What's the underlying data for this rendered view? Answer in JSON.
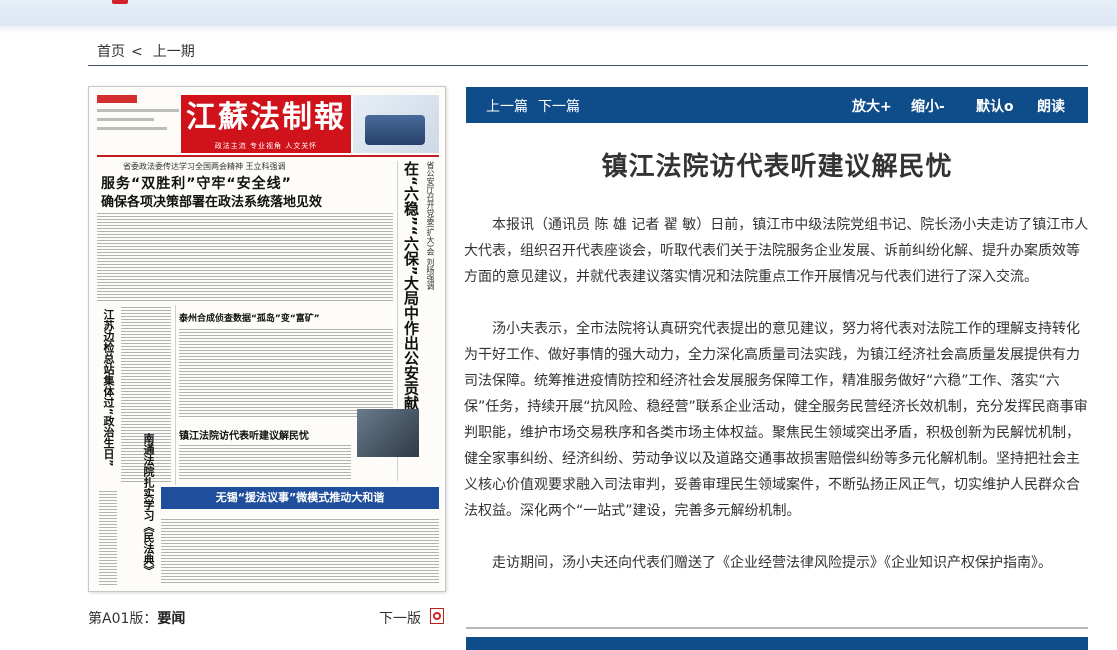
{
  "breadcrumb": {
    "home": "首页",
    "separator": "<",
    "prev_issue": "上一期"
  },
  "newspaper": {
    "masthead": "江蘇法制報",
    "masthead_slogan": "政法主流  专业视角  人文关怀",
    "kicker": "省委政法委传达学习全国两会精神  王立科强调",
    "headline_line1": "服务“双胜利”守牢“安全线”",
    "headline_line2": "确保各项决策部署在政法系统落地见效",
    "vertical_right": "在“六稳”“六保”大局中作出公安贡献",
    "vertical_right_small": "省公安厅召开党委(扩大)会  刘旸强调",
    "vertical_left": "江苏边检总站集体过“政治生日”",
    "vertical_left2": "南通法院扎实学习《民法典》",
    "subhead1": "泰州合成侦查数据“孤岛”变“富矿”",
    "subhead2": "镇江法院访代表听建议解民忧",
    "banner": "无锡“援法议事”微模式推动大和谐"
  },
  "page_info": {
    "label": "第A01版：",
    "section": "要闻"
  },
  "next_page": "下一版",
  "toolbar": {
    "prev": "上一篇",
    "next": "下一篇",
    "zoom_in": "放大+",
    "zoom_out": "缩小-",
    "default": "默认o",
    "read_aloud": "朗读"
  },
  "article": {
    "title": "镇江法院访代表听建议解民忧",
    "paragraphs": [
      "本报讯（通讯员 陈 雄 记者 翟 敏）日前，镇江市中级法院党组书记、院长汤小夫走访了镇江市人大代表，组织召开代表座谈会，听取代表们关于法院服务企业发展、诉前纠纷化解、提升办案质效等方面的意见建议，并就代表建议落实情况和法院重点工作开展情况与代表们进行了深入交流。",
      "汤小夫表示，全市法院将认真研究代表提出的意见建议，努力将代表对法院工作的理解支持转化为干好工作、做好事情的强大动力，全力深化高质量司法实践，为镇江经济社会高质量发展提供有力司法保障。统筹推进疫情防控和经济社会发展服务保障工作，精准服务做好“六稳”工作、落实“六保”任务，持续开展“抗风险、稳经营”联系企业活动，健全服务民营经济长效机制，充分发挥民商事审判职能，维护市场交易秩序和各类市场主体权益。聚焦民生领域突出矛盾，积极创新为民解忧机制，健全家事纠纷、经济纠纷、劳动争议以及道路交通事故损害赔偿纠纷等多元化解机制。坚持把社会主义核心价值观要求融入司法审判，妥善审理民生领域案件，不断弘扬正风正气，切实维护人民群众合法权益。深化两个“一站式”建设，完善多元解纷机制。",
      "走访期间，汤小夫还向代表们赠送了《企业经营法律风险提示》《企业知识产权保护指南》。"
    ]
  }
}
